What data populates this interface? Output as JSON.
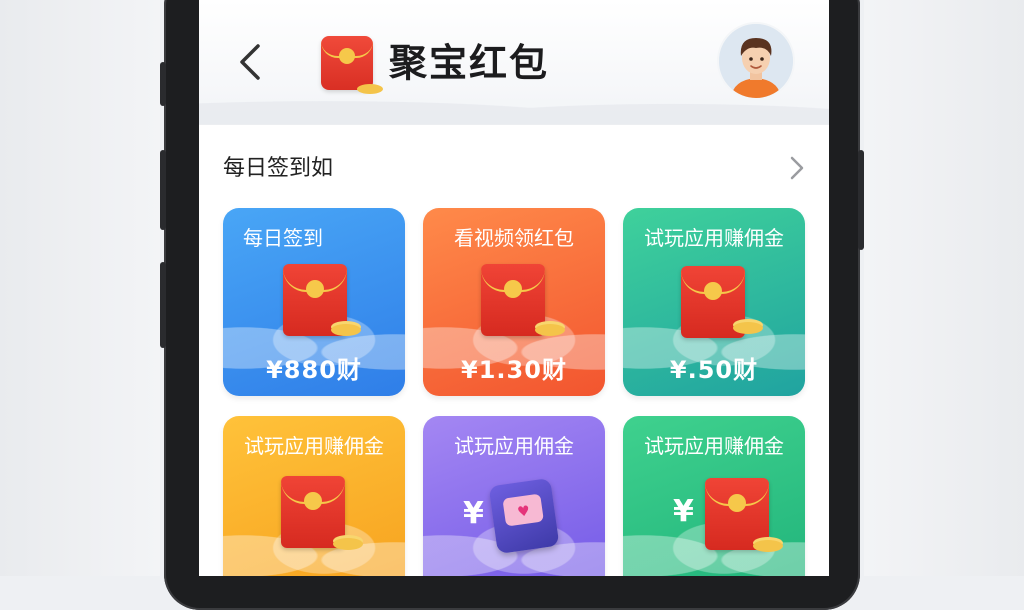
{
  "header": {
    "title": "聚宝红包",
    "back_icon": "chevron-left-icon",
    "avatar_icon": "user-avatar"
  },
  "section": {
    "title": "每日签到如",
    "more_icon": "chevron-right-icon"
  },
  "cards": [
    {
      "label": "每日签到",
      "amount": "¥880财",
      "color": "#3a8ff0",
      "icon": "red-envelope-icon"
    },
    {
      "label": "看视频领红包",
      "amount": "¥1.30财",
      "color": "#f66a3a",
      "icon": "red-envelope-icon"
    },
    {
      "label": "试玩应用赚佣金",
      "amount": "¥.50财",
      "color": "#2ab99c",
      "icon": "red-envelope-icon"
    },
    {
      "label": "试玩应用赚佣金",
      "amount": "",
      "color": "#f8b02c",
      "icon": "red-envelope-icon"
    },
    {
      "label": "试玩应用佣金",
      "amount": "",
      "color": "#8a6eee",
      "icon": "wallet-icon",
      "symbol": "¥"
    },
    {
      "label": "试玩应用赚佣金",
      "amount": "",
      "color": "#28c285",
      "icon": "red-envelope-icon",
      "symbol": "¥"
    }
  ]
}
